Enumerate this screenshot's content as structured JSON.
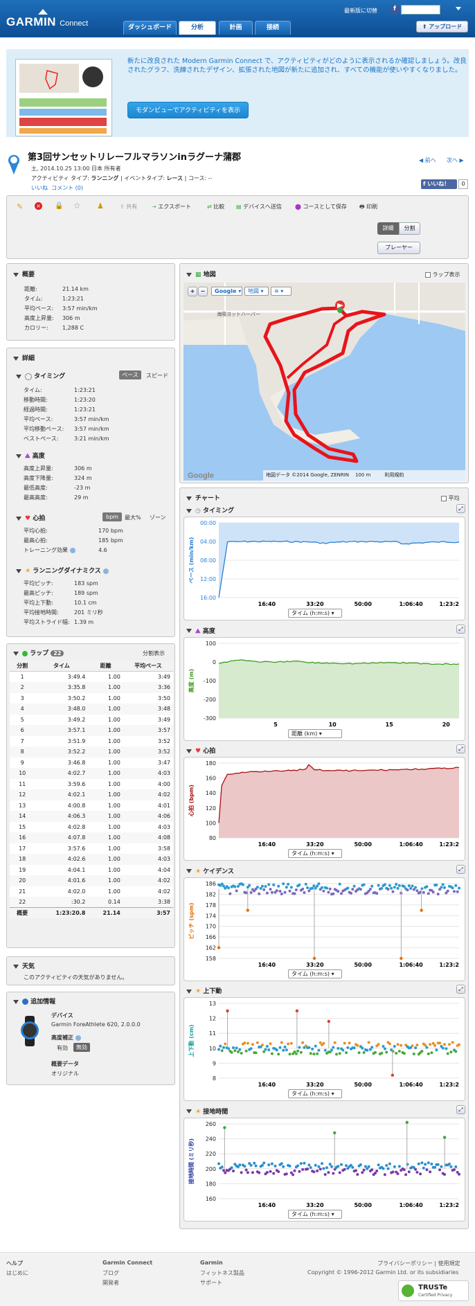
{
  "header": {
    "brand": "GARMIN",
    "brand_sub": "Connect",
    "new_version": "最新版に切替",
    "tabs": [
      "ダッシュボード",
      "分析",
      "計画",
      "接続"
    ],
    "upload": "アップロード"
  },
  "promo": {
    "text": "新たに改良された Modern Garmin Connect で、アクティビティがどのように表示されるか確認しましょう。改良されたグラフ、洗練されたデザイン、拡張された地図が新たに追加され、すべての機能が使いやすくなりました。",
    "button": "モダンビューでアクティビティを表示"
  },
  "activity": {
    "title": "第3回サンセットリレーフルマラソンinラグーナ蒲郡",
    "meta1": "土, 2014.10.25 13:00 日本 所有者",
    "meta2_prefix": "アクティビティ タイプ: ",
    "activity_type": "ランニング",
    "meta2_mid": " | イベントタイプ: ",
    "event_type": "レース",
    "meta2_suffix": " | コース: --",
    "like": "いいね",
    "comments": "コメント (0)",
    "prev": "前へ",
    "next": "次へ",
    "fb_like": "いいね！",
    "fb_count": "0"
  },
  "toolbar": {
    "share": "共有",
    "export": "エクスポート",
    "compare": "比較",
    "send": "デバイスへ送信",
    "save_course": "コースとして保存",
    "print": "印刷",
    "detail": "詳細",
    "split": "分割",
    "player": "プレーヤー"
  },
  "summary": {
    "title": "概要",
    "rows": [
      [
        "距離:",
        "21.14 km"
      ],
      [
        "タイム:",
        "1:23:21"
      ],
      [
        "平均ペース:",
        "3:57 min/km"
      ],
      [
        "高度上昇量:",
        "306 m"
      ],
      [
        "カロリー:",
        "1,288 C"
      ]
    ]
  },
  "details": {
    "title": "詳細",
    "timing": {
      "title": "タイミング",
      "pace_tab": "ペース",
      "speed_tab": "スピード",
      "rows": [
        [
          "タイム:",
          "1:23:21"
        ],
        [
          "移動時間:",
          "1:23:20"
        ],
        [
          "経過時間:",
          "1:23:21"
        ],
        [
          "平均ペース:",
          "3:57 min/km"
        ],
        [
          "平均移動ペース:",
          "3:57 min/km"
        ],
        [
          "ベストペース:",
          "3:21 min/km"
        ]
      ]
    },
    "elevation": {
      "title": "高度",
      "rows": [
        [
          "高度上昇量:",
          "306 m"
        ],
        [
          "高度下降量:",
          "324 m"
        ],
        [
          "最低高度:",
          "-23 m"
        ],
        [
          "最高高度:",
          "29 m"
        ]
      ]
    },
    "hr": {
      "title": "心拍",
      "tabs": [
        "bpm",
        "最大%",
        "ゾーン"
      ],
      "rows": [
        [
          "平均心拍:",
          "170 bpm"
        ],
        [
          "最高心拍:",
          "185 bpm"
        ],
        [
          "トレーニング効果",
          "4.6"
        ]
      ]
    },
    "dynamics": {
      "title": "ランニングダイナミクス",
      "rows": [
        [
          "平均ピッチ:",
          "183 spm"
        ],
        [
          "最高ピッチ:",
          "189 spm"
        ],
        [
          "平均上下動:",
          "10.1 cm"
        ],
        [
          "平均接地時間:",
          "201 ミリ秒"
        ],
        [
          "平均ストライド幅:",
          "1.39 m"
        ]
      ]
    }
  },
  "laps": {
    "title": "ラップ",
    "count": "22",
    "split_view": "分割表示",
    "headers": [
      "分割",
      "タイム",
      "距離",
      "平均ペース"
    ],
    "rows": [
      [
        "1",
        "3:49.4",
        "1.00",
        "3:49"
      ],
      [
        "2",
        "3:35.8",
        "1.00",
        "3:36"
      ],
      [
        "3",
        "3:50.2",
        "1.00",
        "3:50"
      ],
      [
        "4",
        "3:48.0",
        "1.00",
        "3:48"
      ],
      [
        "5",
        "3:49.2",
        "1.00",
        "3:49"
      ],
      [
        "6",
        "3:57.1",
        "1.00",
        "3:57"
      ],
      [
        "7",
        "3:51.9",
        "1.00",
        "3:52"
      ],
      [
        "8",
        "3:52.2",
        "1.00",
        "3:52"
      ],
      [
        "9",
        "3:46.8",
        "1.00",
        "3:47"
      ],
      [
        "10",
        "4:02.7",
        "1.00",
        "4:03"
      ],
      [
        "11",
        "3:59.6",
        "1.00",
        "4:00"
      ],
      [
        "12",
        "4:02.1",
        "1.00",
        "4:02"
      ],
      [
        "13",
        "4:00.8",
        "1.00",
        "4:01"
      ],
      [
        "14",
        "4:06.3",
        "1.00",
        "4:06"
      ],
      [
        "15",
        "4:02.8",
        "1.00",
        "4:03"
      ],
      [
        "16",
        "4:07.8",
        "1.00",
        "4:08"
      ],
      [
        "17",
        "3:57.6",
        "1.00",
        "3:58"
      ],
      [
        "18",
        "4:02.6",
        "1.00",
        "4:03"
      ],
      [
        "19",
        "4:04.1",
        "1.00",
        "4:04"
      ],
      [
        "20",
        "4:01.6",
        "1.00",
        "4:02"
      ],
      [
        "21",
        "4:02.0",
        "1.00",
        "4:02"
      ],
      [
        "22",
        ":30.2",
        "0.14",
        "3:38"
      ]
    ],
    "total": [
      "概要",
      "1:23:20.8",
      "21.14",
      "3:57"
    ]
  },
  "weather": {
    "title": "天気",
    "text": "このアクティビティの天気がありません。"
  },
  "extra": {
    "title": "追加情報",
    "device_label": "デバイス",
    "device": "Garmin ForeAthlete 620, 2.0.0.0",
    "elev_corr": "高度補正",
    "enabled": "有効",
    "disabled": "無効",
    "summary_data": "概要データ",
    "original": "オリジナル"
  },
  "map": {
    "title": "地図",
    "lap_display": "ラップ表示",
    "map_type": "Google",
    "layer": "地図",
    "place": "海陽ヨットハーバー",
    "attribution": "地図データ ©2014 Google, ZENRIN",
    "scale": "100 m",
    "terms": "利用規約",
    "google": "Google"
  },
  "charts_panel": {
    "title": "チャート",
    "average": "平均"
  },
  "chart_data": [
    {
      "type": "area",
      "title": "タイミング",
      "ylabel": "ペース (min/km)",
      "yticks": [
        "00:00",
        "04:00",
        "08:00",
        "12:00",
        "16:00"
      ],
      "xticks": [
        "16:40",
        "33:20",
        "50:00",
        "1:06:40",
        "1:23:2"
      ],
      "xaxis": "タイム (h:m:s)",
      "x": [
        0,
        3,
        8,
        20,
        33,
        35,
        42,
        50,
        62,
        63,
        75,
        83
      ],
      "y": [
        16,
        4.1,
        4.0,
        4.0,
        4.1,
        4.4,
        4.1,
        4.0,
        4.1,
        4.5,
        4.1,
        4.1
      ],
      "color": "#2a7fd4"
    },
    {
      "type": "area",
      "title": "高度",
      "ylabel": "高度 (m)",
      "yticks": [
        "100",
        "0",
        "-100",
        "-200",
        "-300"
      ],
      "xticks": [
        "5",
        "10",
        "15",
        "20"
      ],
      "xaxis": "距離 (km)",
      "x": [
        0,
        1,
        2,
        3,
        5,
        7,
        8,
        10,
        12,
        15,
        17,
        19,
        21.14
      ],
      "y": [
        -8,
        5,
        12,
        4,
        -2,
        5,
        -4,
        -5,
        -8,
        -3,
        -5,
        -12,
        -10
      ],
      "color": "#3c9c1c"
    },
    {
      "type": "area",
      "title": "心拍",
      "ylabel": "心拍 (bpm)",
      "yticks": [
        "180",
        "160",
        "140",
        "120",
        "100",
        "80"
      ],
      "xticks": [
        "16:40",
        "33:20",
        "50:00",
        "1:06:40",
        "1:23:2"
      ],
      "xaxis": "タイム (h:m:s)",
      "x": [
        0,
        1,
        3,
        10,
        20,
        25,
        30,
        31,
        33,
        40,
        50,
        60,
        70,
        80,
        83
      ],
      "y": [
        100,
        150,
        165,
        168,
        170,
        170,
        172,
        178,
        171,
        170,
        170,
        171,
        172,
        173,
        174
      ],
      "color": "#aa1010"
    },
    {
      "type": "scatter",
      "title": "ケイデンス",
      "ylabel": "ピッチ (spm)",
      "yticks": [
        "186",
        "182",
        "178",
        "174",
        "170",
        "166",
        "162",
        "158"
      ],
      "xticks": [
        "16:40",
        "33:20",
        "50:00",
        "1:06:40",
        "1:23:2"
      ],
      "xaxis": "タイム (h:m:s)",
      "center": 184,
      "spread": 2,
      "outliers": [
        [
          0,
          162
        ],
        [
          10,
          176
        ],
        [
          33,
          158
        ],
        [
          63,
          158
        ],
        [
          70,
          176
        ]
      ]
    },
    {
      "type": "scatter",
      "title": "上下動",
      "ylabel": "上下動 (cm)",
      "yticks": [
        "13",
        "12",
        "11",
        "10",
        "9",
        "8"
      ],
      "xticks": [
        "16:40",
        "33:20",
        "50:00",
        "1:06:40",
        "1:23:2"
      ],
      "xaxis": "タイム (h:m:s)",
      "center": 10.0,
      "spread": 0.4,
      "outliers": [
        [
          3,
          12.5
        ],
        [
          27,
          12.5
        ],
        [
          38,
          11.8
        ],
        [
          60,
          8.2
        ]
      ]
    },
    {
      "type": "scatter",
      "title": "接地時間",
      "ylabel": "接地時間 (ミリ秒)",
      "yticks": [
        "260",
        "240",
        "220",
        "200",
        "180",
        "160"
      ],
      "xticks": [
        "16:40",
        "33:20",
        "50:00",
        "1:06:40",
        "1:23:2"
      ],
      "xaxis": "タイム (h:m:s)",
      "center": 200,
      "spread": 8,
      "outliers": [
        [
          2,
          255
        ],
        [
          40,
          248
        ],
        [
          65,
          262
        ],
        [
          78,
          242
        ]
      ]
    }
  ],
  "footer": {
    "help": "ヘルプ",
    "intro": "はじめに",
    "gc": "Garmin Connect",
    "blog": "ブログ",
    "dev": "開発者",
    "garmin": "Garmin",
    "fitness": "フィットネス製品",
    "support": "サポート",
    "privacy": "プライバシーポリシー | 使用規定",
    "copyright": "Copyright © 1996-2012 Garmin Ltd. or its subsidiaries",
    "truste": "TRUSTe",
    "truste_sub": "Certified Privacy"
  }
}
